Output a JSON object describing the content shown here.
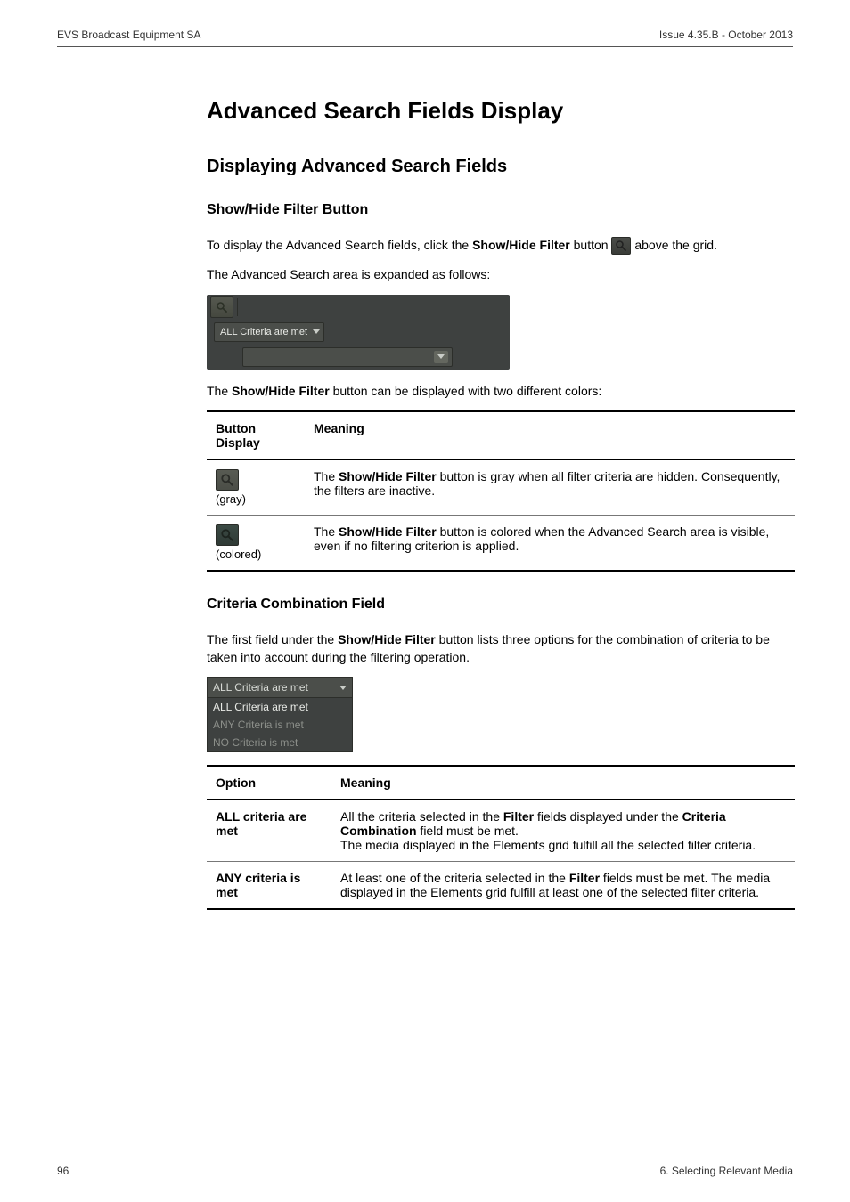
{
  "header": {
    "left": "EVS Broadcast Equipment SA",
    "right": "Issue 4.35.B - October 2013"
  },
  "title": "Advanced Search Fields Display",
  "h2": "Displaying Advanced Search Fields",
  "show_hide": {
    "title": "Show/Hide Filter Button",
    "intro_pre": "To display the Advanced Search fields, click the ",
    "intro_bold": "Show/Hide Filter",
    "intro_mid": " button ",
    "intro_post": " above the grid.",
    "expanded": "The Advanced Search area is expanded as follows:",
    "colors_line_pre": "The ",
    "colors_line_bold": "Show/Hide Filter",
    "colors_line_post": " button can be displayed with two different colors:"
  },
  "panel": {
    "criteria_label": "ALL Criteria are met"
  },
  "button_table": {
    "head_button": "Button Display",
    "head_meaning": "Meaning",
    "row_gray_label": "(gray)",
    "row_gray_pre": "The ",
    "row_gray_bold": "Show/Hide Filter",
    "row_gray_post": " button is gray when all filter criteria are hidden. Consequently, the filters are inactive.",
    "row_col_label": "(colored)",
    "row_col_pre": "The ",
    "row_col_bold": "Show/Hide Filter",
    "row_col_post": " button is colored when the Advanced Search area is visible, even if no filtering criterion is applied."
  },
  "criteria": {
    "title": "Criteria Combination Field",
    "intro_pre": "The first field under the ",
    "intro_bold": "Show/Hide Filter",
    "intro_post": " button lists three options for the combination of criteria to be taken into account during the filtering operation.",
    "list_head": "ALL Criteria are met",
    "list_item1": "ALL Criteria are met",
    "list_item2": "ANY Criteria is met",
    "list_item3": "NO Criteria is met"
  },
  "option_table": {
    "head_option": "Option",
    "head_meaning": "Meaning",
    "r1_opt": "ALL criteria are met",
    "r1_pre": "All the criteria selected in the ",
    "r1_b1": "Filter",
    "r1_mid1": " fields displayed under the ",
    "r1_b2": "Criteria Combination",
    "r1_mid2": " field must be met.",
    "r1_line2": "The media displayed in the Elements grid fulfill all the selected filter criteria.",
    "r2_opt": "ANY criteria is met",
    "r2_pre": "At least one of the criteria selected in the ",
    "r2_b1": "Filter",
    "r2_mid1": " fields must be met. The media displayed in the Elements grid fulfill at least one of the selected filter criteria."
  },
  "footer": {
    "left": "96",
    "right": "6. Selecting Relevant Media"
  }
}
